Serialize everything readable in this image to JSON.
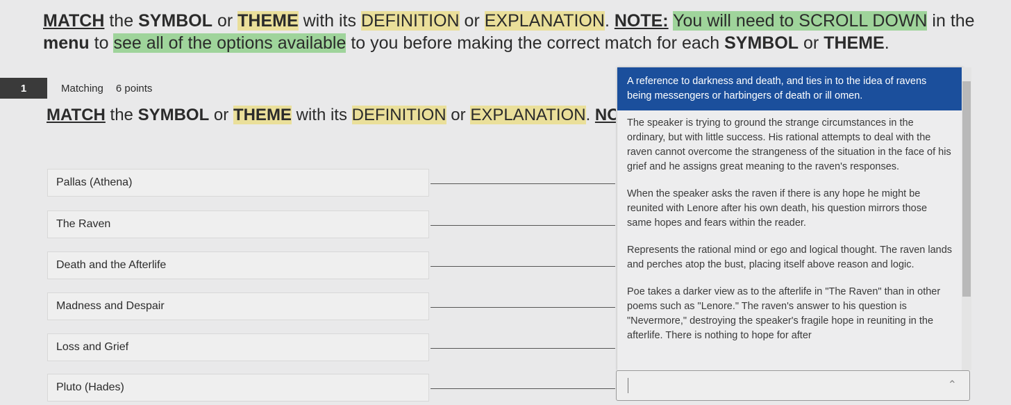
{
  "instructions": {
    "segments": [
      {
        "t": "MATCH",
        "c": "b u"
      },
      {
        "t": " the ",
        "c": ""
      },
      {
        "t": "SYMBOL",
        "c": "b"
      },
      {
        "t": " or ",
        "c": ""
      },
      {
        "t": "THEME",
        "c": "b y"
      },
      {
        "t": " with its ",
        "c": ""
      },
      {
        "t": "DEFINITION",
        "c": "y"
      },
      {
        "t": " or ",
        "c": ""
      },
      {
        "t": "EXPLANATION",
        "c": "y"
      },
      {
        "t": ". ",
        "c": ""
      },
      {
        "t": "NOTE:",
        "c": "b u"
      },
      {
        "t": " ",
        "c": ""
      },
      {
        "t": "You will need to SCROLL DOWN",
        "c": "g"
      },
      {
        "t": " in the ",
        "c": ""
      },
      {
        "t": "menu",
        "c": "b"
      },
      {
        "t": " to ",
        "c": ""
      },
      {
        "t": "see all of the options available",
        "c": "g"
      },
      {
        "t": " to you before making the correct match for each ",
        "c": ""
      },
      {
        "t": "SYMBOL",
        "c": "b"
      },
      {
        "t": " or ",
        "c": ""
      },
      {
        "t": "THEME",
        "c": "b"
      },
      {
        "t": ".",
        "c": ""
      }
    ]
  },
  "question": {
    "number": "1",
    "type": "Matching",
    "points": "6 points"
  },
  "items": [
    "Pallas (Athena)",
    "The Raven",
    "Death and the Afterlife",
    "Madness and Despair",
    "Loss and Grief",
    "Pluto (Hades)"
  ],
  "options": [
    "A reference to darkness and death, and ties in to the idea of ravens being messengers or harbingers of death or ill omen.",
    "The speaker is trying to ground the strange circumstances in the ordinary, but with little success. His rational attempts to deal with the raven cannot overcome the strangeness of the situation in the face of his grief and he assigns great meaning to the raven's responses.",
    "When the speaker asks the raven if there is any hope he might be reunited with Lenore after his own death, his question mirrors those same hopes and fears within the reader.",
    "Represents the rational mind or ego and logical thought. The raven lands and perches atop the bust, placing itself above reason and logic.",
    "Poe takes a darker view as to the afterlife in \"The Raven\" than in other poems such as \"Lenore.\" The raven's answer to his question is \"Nevermore,\" destroying the speaker's fragile hope in reuniting in the afterlife. There is nothing to hope for after"
  ],
  "selected_option": 0,
  "colors": {
    "selected": "#1b4f9c",
    "highlight_yellow": "#eadf9a",
    "highlight_green": "#9fd49b"
  }
}
